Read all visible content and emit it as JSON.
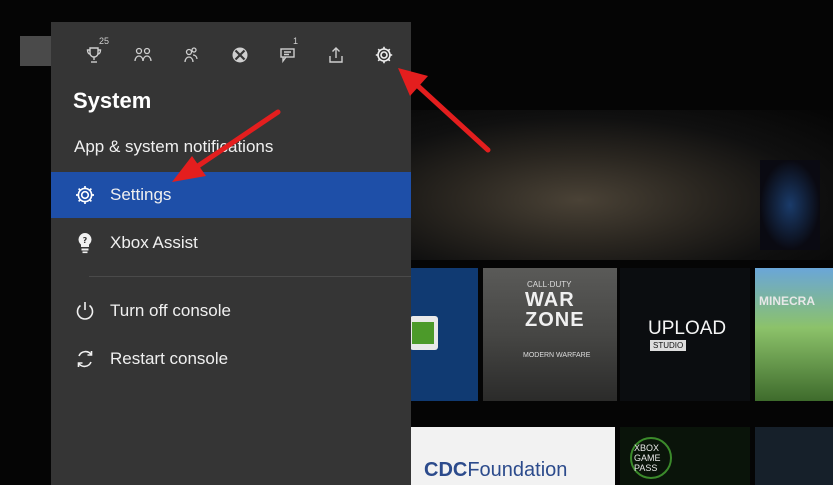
{
  "guide": {
    "tabs": [
      {
        "name": "achievements",
        "badge": "25"
      },
      {
        "name": "friends",
        "badge": ""
      },
      {
        "name": "party",
        "badge": ""
      },
      {
        "name": "xbox",
        "badge": ""
      },
      {
        "name": "messages",
        "badge": "1"
      },
      {
        "name": "share",
        "badge": ""
      },
      {
        "name": "system",
        "badge": ""
      }
    ],
    "title": "System",
    "items": [
      {
        "label": "App & system notifications"
      },
      {
        "label": "Settings"
      },
      {
        "label": "Xbox Assist"
      },
      {
        "label": "Turn off console"
      },
      {
        "label": "Restart console"
      }
    ],
    "selected_item": "Settings"
  },
  "background": {
    "warzone": {
      "small": "CALL·DUTY",
      "big1": "WAR",
      "big2": "ZONE",
      "sub": "MODERN WARFARE"
    },
    "upload": {
      "big": "UPLOAD",
      "sub": "STUDIO"
    },
    "minecraft": "MINECRA",
    "cdc": {
      "part1": "CDC",
      "part2": "Foundation"
    },
    "gamepass": {
      "l1": "XBOX",
      "l2": "GAME",
      "l3": "PASS"
    }
  },
  "colors": {
    "panel": "#353535",
    "selection": "#1e4fa8",
    "annotation_arrow": "#e41e1e"
  }
}
